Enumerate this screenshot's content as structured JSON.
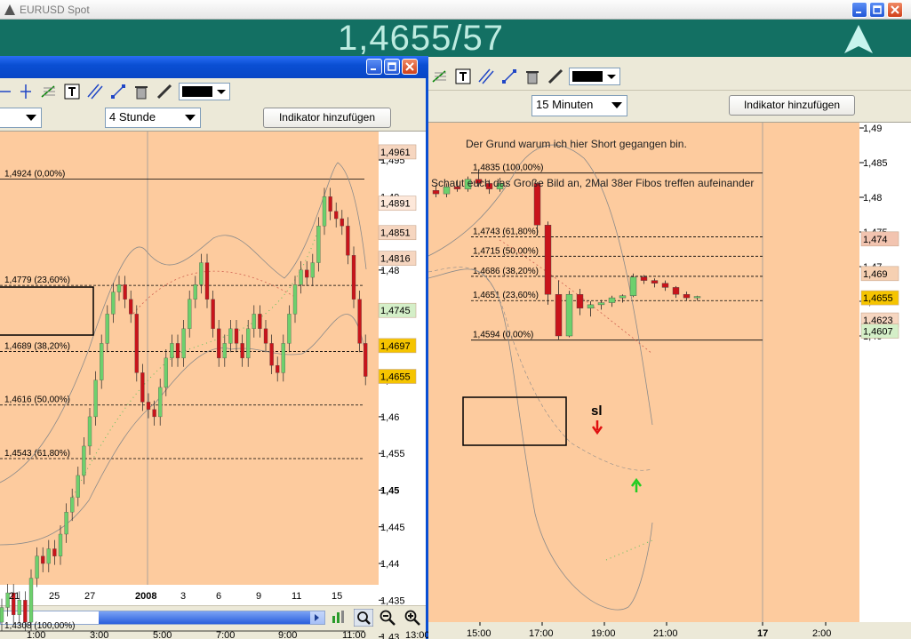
{
  "back_window": {
    "title": "EURUSD Spot",
    "quote": "1,4655/57",
    "timeframe": "15 Minuten",
    "add_indicator": "Indikator hinzufügen",
    "annotation_1": "Der Grund warum ich hier Short gegangen bin.",
    "annotation_2": "Schaut euch das Große Bild an, 2Mal 38er Fibos treffen  aufeinander",
    "sl_label": "sl",
    "y_ticks": [
      "1,49",
      "1,485",
      "1,48",
      "1,475",
      "1,47",
      "1,465",
      "1,46"
    ],
    "price_tags": [
      "1,474",
      "1,469",
      "1,4655",
      "1,4623",
      "1,4607"
    ],
    "x_ticks": [
      "15:00",
      "17:00",
      "19:00",
      "21:00",
      "17",
      "2:00"
    ],
    "fib_levels": [
      "1,4835 (100,00%)",
      "1,4743 (61,80%)",
      "1,4715 (50,00%)",
      "1,4686 (38,20%)",
      "1,4651 (23,60%)",
      "1,4594 (0,00%)"
    ]
  },
  "front_window": {
    "timeframe": "4 Stunde",
    "add_indicator": "Indikator hinzufügen",
    "y_ticks": [
      "1,495",
      "1,49",
      "1,485",
      "1,48",
      "1,475",
      "1,47",
      "1,465",
      "1,46",
      "1,455",
      "1,45",
      "1,445",
      "1,44",
      "1,435",
      "1,43"
    ],
    "price_tags": [
      "1,4961",
      "1,4891",
      "1,4851",
      "1,4816",
      "1,4745",
      "1,4697",
      "1,4655"
    ],
    "x_ticks": [
      "21",
      "25",
      "27",
      "2008",
      "3",
      "6",
      "9",
      "11",
      "15"
    ],
    "fib_levels": [
      "1,4924 (0,00%)",
      "1,4779 (23,60%)",
      "1,4689 (38,20%)",
      "1,4616 (50,00%)",
      "1,4543 (61,80%)",
      "1,4308 (100,00%)"
    ],
    "bottom_times": [
      "1:00",
      "3:00",
      "5:00",
      "7:00",
      "9:00",
      "11:00",
      "13:00"
    ]
  },
  "colors": {
    "chart_bg": "#fdcb9e",
    "quote_bar": "#137063",
    "bull": "#6dd06d",
    "bear": "#c8141b"
  }
}
